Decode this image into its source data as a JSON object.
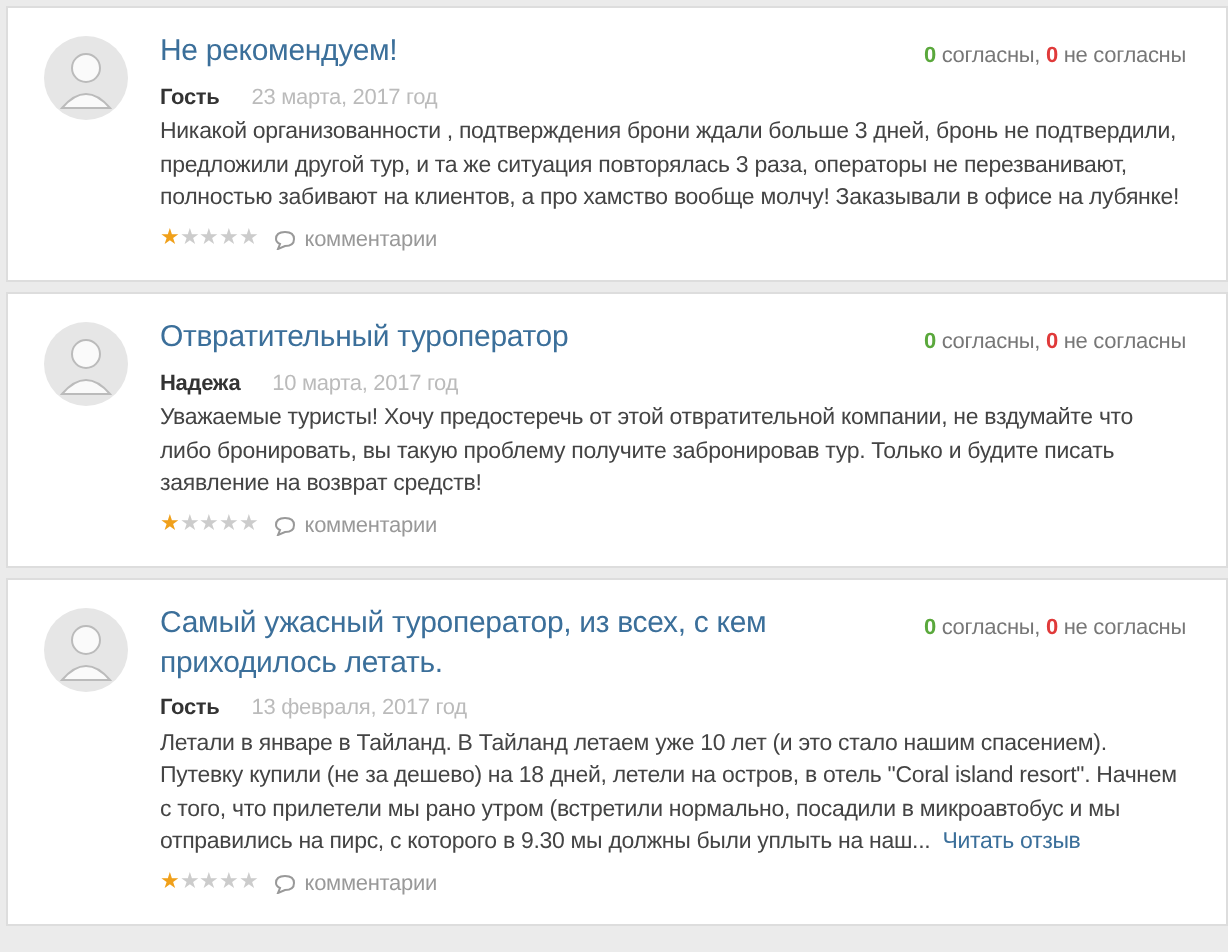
{
  "reviews": [
    {
      "title": "Не рекомендуем!",
      "author": "Гость",
      "date": "23 марта, 2017 год",
      "agree": "0",
      "agree_label": "согласны,",
      "disagree": "0",
      "disagree_label": "не согласны",
      "text": "Никакой организованности , подтверждения брони ждали больше 3 дней, бронь не подтвердили, предложили другой тур, и та же ситуация повторялась 3 раза, операторы не перезванивают, полностью забивают на клиентов, а про хамство вообще молчу! Заказывали в офисе на лубянке!",
      "stars": 1,
      "comments": "комментарии"
    },
    {
      "title": "Отвратительный туроператор",
      "author": "Надежа",
      "date": "10 марта, 2017 год",
      "agree": "0",
      "agree_label": "согласны,",
      "disagree": "0",
      "disagree_label": "не согласны",
      "text": "Уважаемые туристы! Хочу предостеречь от этой отвратительной компании, не вздумайте что либо бронировать, вы такую проблему получите забронировав тур. Только и будите писать заявление на возврат средств!",
      "stars": 1,
      "comments": "комментарии"
    },
    {
      "title": "Самый ужасный туроператор, из всех, с кем приходилось летать.",
      "author": "Гость",
      "date": "13 февраля, 2017 год",
      "agree": "0",
      "agree_label": "согласны,",
      "disagree": "0",
      "disagree_label": "не согласны",
      "text": "Летали в январе в Тайланд. В Тайланд летаем уже 10 лет (и это стало нашим спасением). Путевку купили (не за дешево) на 18 дней, летели на остров, в отель \"Coral island resort\". Начнем с того, что прилетели мы рано утром (встретили нормально, посадили в микроавтобус и мы отправились на пирс, с которого в 9.30 мы должны были уплыть на наш...",
      "read_more": "Читать отзыв",
      "stars": 1,
      "comments": "комментарии"
    }
  ]
}
